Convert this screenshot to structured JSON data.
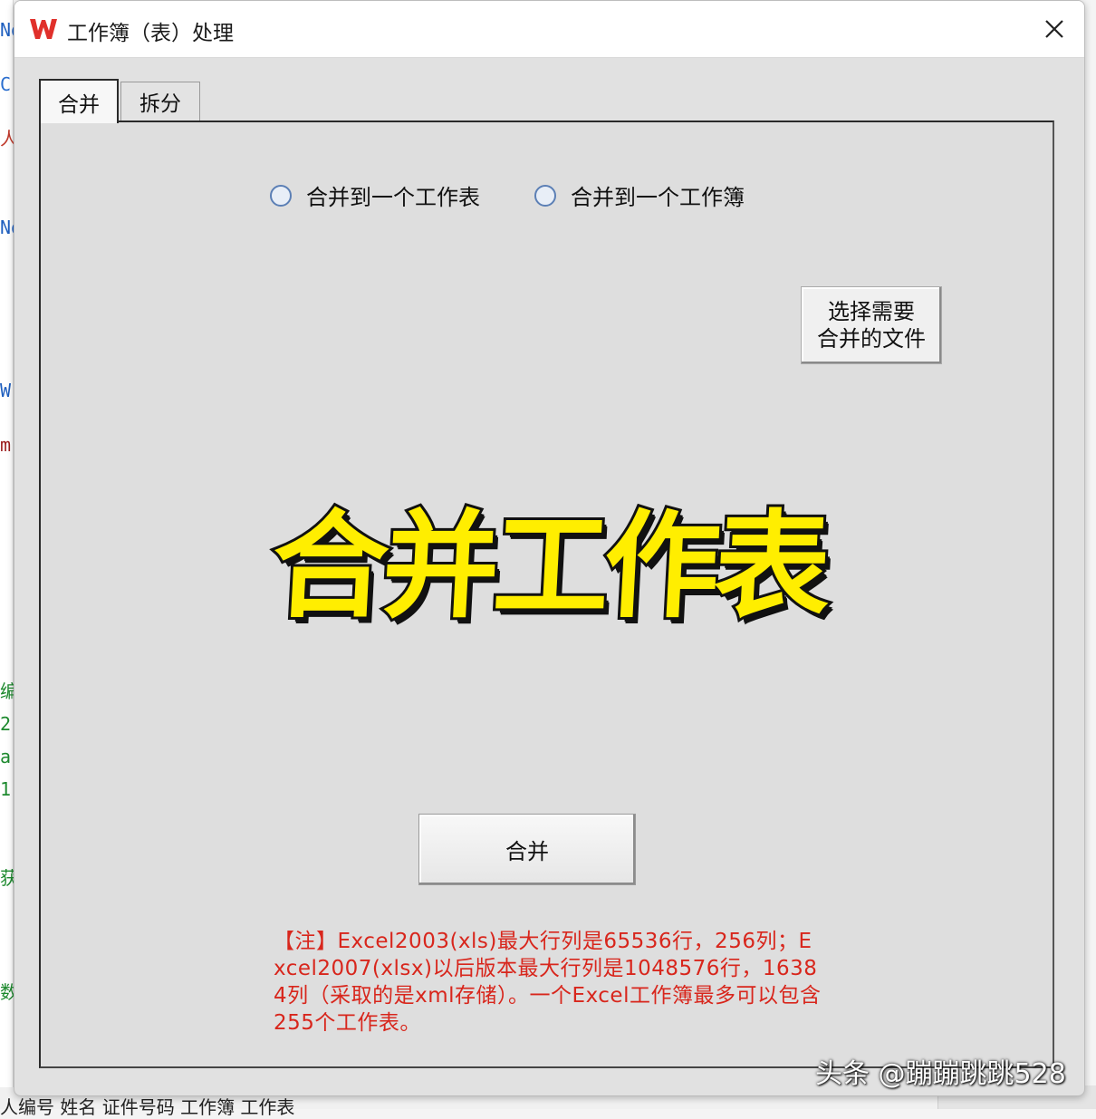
{
  "window": {
    "title": "工作簿（表）处理"
  },
  "tabs": [
    {
      "label": "合并",
      "active": true
    },
    {
      "label": "拆分",
      "active": false
    }
  ],
  "options": [
    {
      "label": "合并到一个工作表",
      "selected": false
    },
    {
      "label": "合并到一个工作簿",
      "selected": false
    }
  ],
  "select_button": {
    "label_line1": "选择需要",
    "label_line2": "合并的文件"
  },
  "overlay_title": "合并工作表",
  "merge_button": "合并",
  "note": "【注】Excel2003(xls)最大行列是65536行，256列；Excel2007(xlsx)以后版本最大行列是1048576行，16384列（采取的是xml存储）。一个Excel工作簿最多可以包含255个工作表。",
  "watermark": "头条 @蹦蹦跳跳528",
  "background": {
    "fragments": [
      "No",
      "C",
      "人",
      "No",
      "W",
      "m",
      "编",
      "2",
      "a",
      "1",
      "获",
      "数"
    ],
    "bottom_text": "人编号 姓名 证件号码 工作簿 工作表"
  },
  "colors": {
    "brand_red": "#e0302b",
    "note_red": "#d8261c",
    "overlay_yellow": "#ffee00",
    "radio_blue": "#5b7fb5"
  }
}
